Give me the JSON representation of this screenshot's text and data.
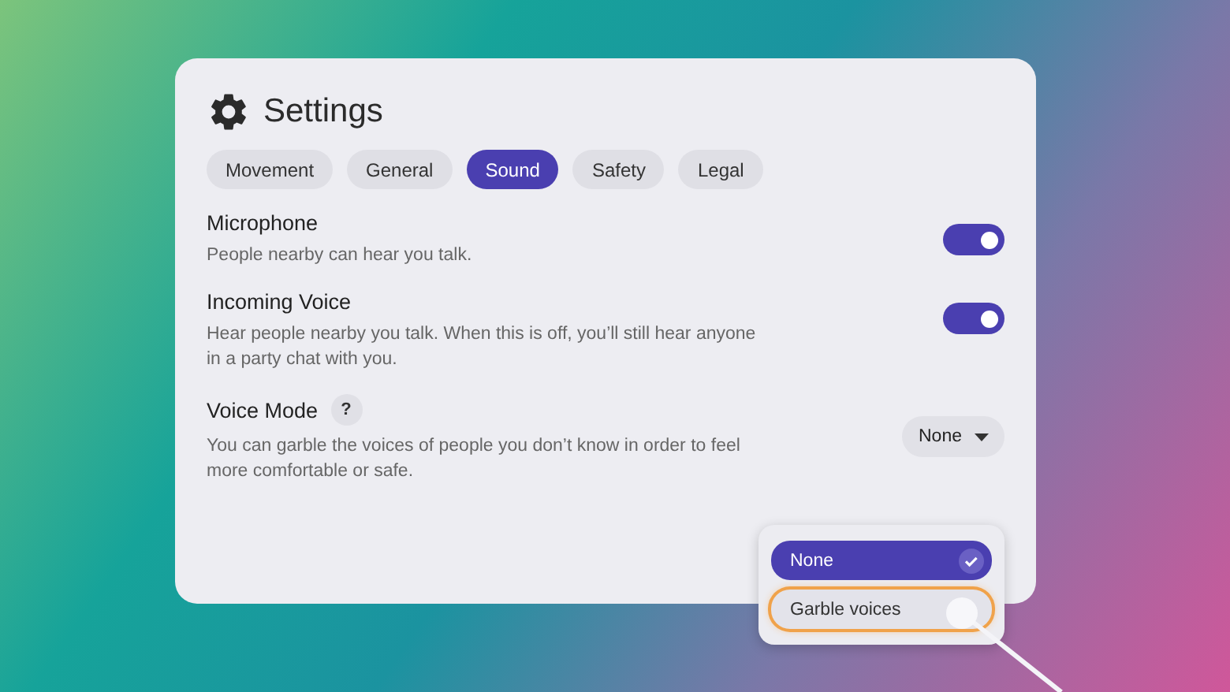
{
  "window": {
    "title": "Settings"
  },
  "tabs": [
    {
      "label": "Movement",
      "selected": false
    },
    {
      "label": "General",
      "selected": false
    },
    {
      "label": "Sound",
      "selected": true
    },
    {
      "label": "Safety",
      "selected": false
    },
    {
      "label": "Legal",
      "selected": false
    }
  ],
  "settings": [
    {
      "kind": "toggle",
      "title": "Microphone",
      "description": "People nearby can hear you talk.",
      "on": true
    },
    {
      "kind": "toggle",
      "title": "Incoming Voice",
      "description": "Hear people nearby you talk. When this is off, you’ll still hear anyone in a party chat with you.",
      "on": true
    },
    {
      "kind": "dropdown",
      "title": "Voice Mode",
      "help": "?",
      "description": "You can garble the voices of people you don’t know in order to feel more comfortable or safe.",
      "value": "None"
    }
  ],
  "menu": [
    {
      "label": "None",
      "selected": true,
      "focused": false
    },
    {
      "label": "Garble voices",
      "selected": false,
      "focused": true
    }
  ]
}
